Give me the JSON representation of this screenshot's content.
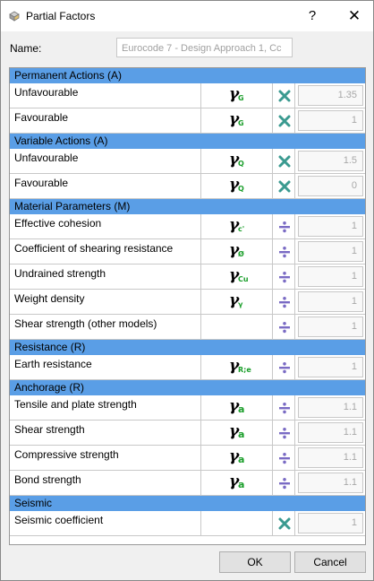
{
  "window": {
    "title": "Partial Factors",
    "help_glyph": "?",
    "close_glyph": "✕"
  },
  "name": {
    "label": "Name:",
    "value": "Eurocode 7 - Design Approach 1, Cc"
  },
  "sections": [
    {
      "title": "Permanent Actions (A)",
      "rows": [
        {
          "label": "Unfavourable",
          "sub": "G",
          "action": "multiply-icon",
          "value": "1.35"
        },
        {
          "label": "Favourable",
          "sub": "G",
          "action": "multiply-icon",
          "value": "1"
        }
      ]
    },
    {
      "title": "Variable Actions (A)",
      "rows": [
        {
          "label": "Unfavourable",
          "sub": "Q",
          "action": "multiply-icon",
          "value": "1.5"
        },
        {
          "label": "Favourable",
          "sub": "Q",
          "action": "multiply-icon",
          "value": "0"
        }
      ]
    },
    {
      "title": "Material Parameters (M)",
      "rows": [
        {
          "label": "Effective cohesion",
          "sub": "c'",
          "action": "divide-icon",
          "value": "1"
        },
        {
          "label": "Coefficient of shearing resistance",
          "sub": "Ø",
          "action": "divide-icon",
          "value": "1"
        },
        {
          "label": "Undrained strength",
          "sub": "Cu",
          "action": "divide-icon",
          "value": "1"
        },
        {
          "label": "Weight density",
          "sub": "γ",
          "action": "divide-icon",
          "value": "1"
        },
        {
          "label": "Shear strength (other models)",
          "sub": "",
          "action": "divide-icon",
          "value": "1"
        }
      ]
    },
    {
      "title": "Resistance (R)",
      "rows": [
        {
          "label": "Earth resistance",
          "sub": "R;e",
          "action": "divide-icon",
          "value": "1"
        }
      ]
    },
    {
      "title": "Anchorage (R)",
      "rows": [
        {
          "label": "Tensile and plate strength",
          "sub": "a",
          "action": "divide-icon",
          "value": "1.1"
        },
        {
          "label": "Shear strength",
          "sub": "a",
          "action": "divide-icon",
          "value": "1.1"
        },
        {
          "label": "Compressive strength",
          "sub": "a",
          "action": "divide-icon",
          "value": "1.1"
        },
        {
          "label": "Bond strength",
          "sub": "a",
          "action": "divide-icon",
          "value": "1.1"
        }
      ]
    },
    {
      "title": "Seismic",
      "rows": [
        {
          "label": "Seismic coefficient",
          "sub": "",
          "action": "multiply-icon",
          "value": "1"
        }
      ]
    }
  ],
  "symbol": {
    "gamma": "γ"
  },
  "buttons": {
    "ok": "OK",
    "cancel": "Cancel"
  },
  "colors": {
    "section_header": "#5a9ee6",
    "subscript": "#1a9e2a",
    "multiply_icon": "#3a9a90",
    "divide_icon": "#7a6bc4"
  }
}
